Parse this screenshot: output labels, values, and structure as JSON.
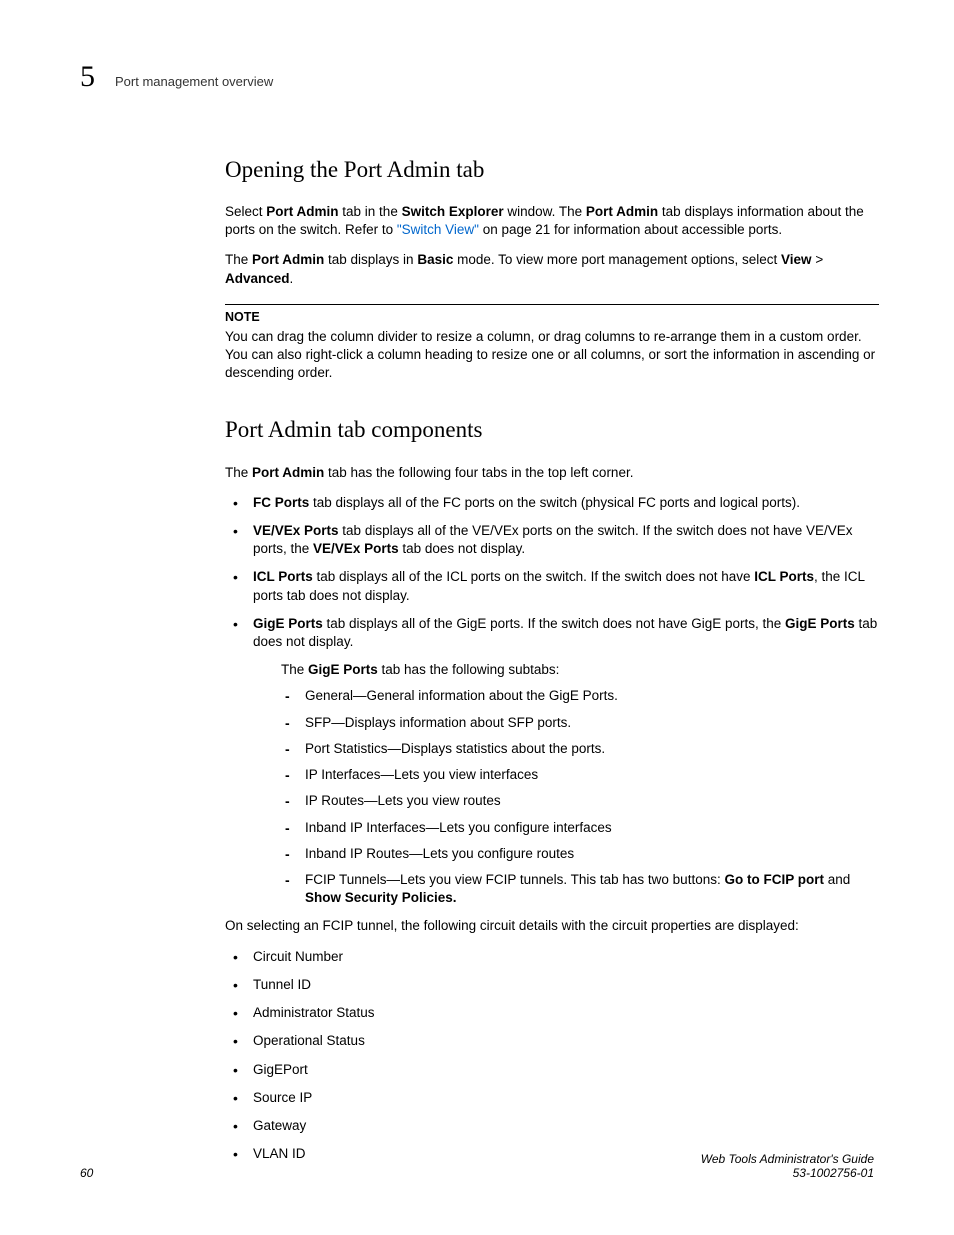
{
  "header": {
    "chapter": "5",
    "title": "Port management overview"
  },
  "section1": {
    "heading": "Opening the Port Admin tab",
    "p1_a": "Select ",
    "p1_b": "Port Admin",
    "p1_c": " tab in the ",
    "p1_d": "Switch Explorer",
    "p1_e": " window. The ",
    "p1_f": "Port Admin",
    "p1_g": " tab displays information about the ports on the switch. Refer to ",
    "p1_link": "\"Switch View\"",
    "p1_h": " on page 21 for information about accessible ports.",
    "p2_a": "The ",
    "p2_b": "Port Admin",
    "p2_c": " tab displays in ",
    "p2_d": "Basic",
    "p2_e": " mode. To view more port management options, select ",
    "p2_f": "View",
    "p2_g": " > ",
    "p2_h": "Advanced",
    "p2_i": ".",
    "note_label": "NOTE",
    "note_text": "You can drag the column divider to resize a column, or drag columns to re-arrange them in a custom order. You can also right-click a column heading to resize one or all columns, or sort the information in ascending or descending order."
  },
  "section2": {
    "heading": "Port Admin tab components",
    "intro_a": "The ",
    "intro_b": "Port Admin",
    "intro_c": " tab has the following four tabs in the top left corner.",
    "b1_a": "FC Ports",
    "b1_b": " tab displays all of the FC ports on the switch (physical FC ports and logical ports).",
    "b2_a": "VE/VEx Ports",
    "b2_b": " tab displays all of the VE/VEx ports on the switch. If the switch does not have VE/VEx ports, the ",
    "b2_c": "VE/VEx Ports",
    "b2_d": " tab does not display.",
    "b3_a": "ICL Ports",
    "b3_b": " tab displays all of the ICL ports on the switch. If the switch does not have ",
    "b3_c": "ICL Ports",
    "b3_d": ", the ICL ports tab does not display.",
    "b4_a": "GigE Ports",
    "b4_b": " tab displays all of the GigE ports. If the switch does not have GigE ports, the ",
    "b4_c": "GigE Ports",
    "b4_d": " tab does not display.",
    "subtabs_intro_a": "The ",
    "subtabs_intro_b": "GigE Ports",
    "subtabs_intro_c": " tab has the following subtabs:",
    "sub1": "General—General information about the GigE Ports.",
    "sub2": "SFP—Displays information about SFP ports.",
    "sub3": "Port Statistics—Displays statistics about the ports.",
    "sub4": "IP Interfaces—Lets you view interfaces",
    "sub5": "IP Routes—Lets you view routes",
    "sub6": "Inband IP Interfaces—Lets you configure interfaces",
    "sub7": "Inband IP Routes—Lets you configure routes",
    "sub8_a": "FCIP Tunnels—Lets you view FCIP tunnels. This tab has two buttons: ",
    "sub8_b": "Go to FCIP port",
    "sub8_c": " and ",
    "sub8_d": "Show Security Policies.",
    "circuit_intro": "On selecting an FCIP tunnel, the following circuit details with the circuit properties are displayed:",
    "c1": "Circuit Number",
    "c2": "Tunnel ID",
    "c3": "Administrator Status",
    "c4": "Operational Status",
    "c5": "GigEPort",
    "c6": "Source IP",
    "c7": "Gateway",
    "c8": "VLAN ID"
  },
  "footer": {
    "page": "60",
    "title": "Web Tools Administrator's Guide",
    "docnum": "53-1002756-01"
  }
}
